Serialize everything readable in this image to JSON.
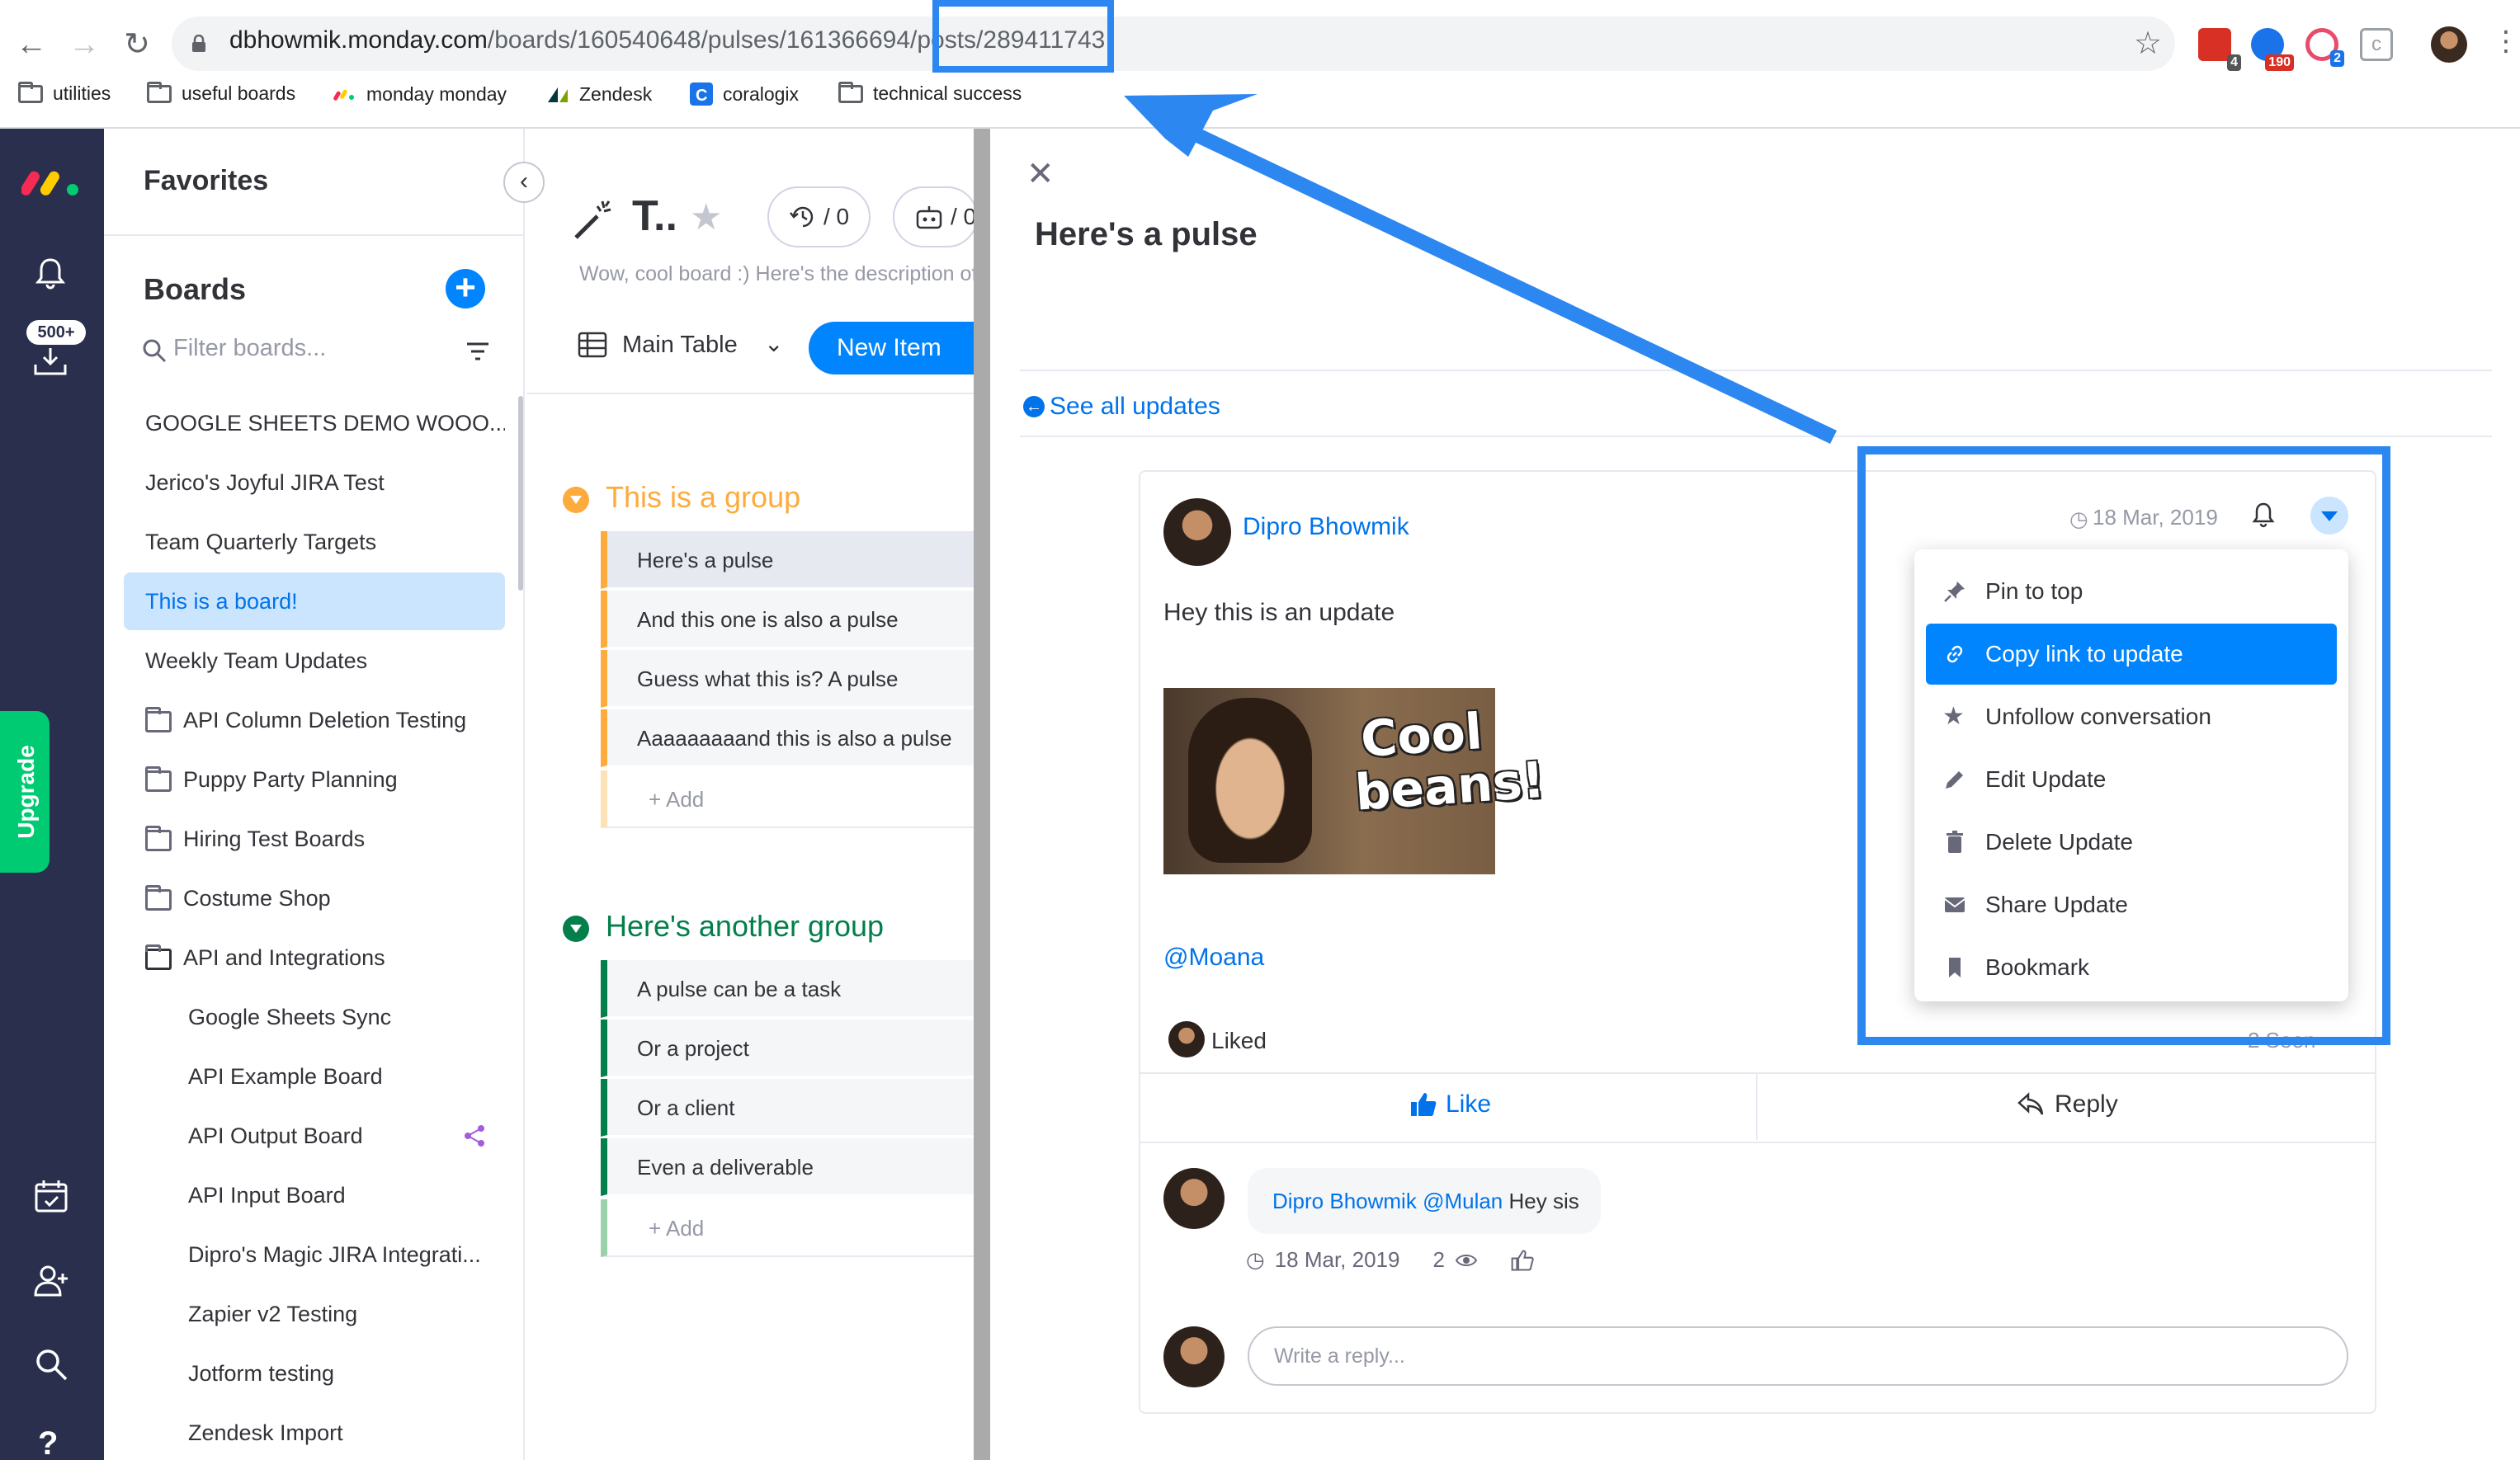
{
  "browser": {
    "url_host": "dbhowmik.monday.com",
    "url_path": "/boards/160540648/pulses/161366694/posts/289411743",
    "extensions": [
      {
        "icon": "calendar-ext-icon",
        "badge": "4",
        "color": "#d93025",
        "badge_color": "#555555"
      },
      {
        "icon": "check-ext-icon",
        "badge": "190",
        "color": "#1a73e8",
        "badge_color": "#d93025"
      },
      {
        "icon": "target-ext-icon",
        "badge": "2",
        "color": "#e94b6a",
        "badge_color": "#1a73e8"
      },
      {
        "icon": "c-ext-icon",
        "badge": "",
        "color": "#9aa0a6",
        "badge_color": ""
      }
    ],
    "bookmarks": [
      {
        "label": "utilities",
        "icon": "folder-icon"
      },
      {
        "label": "useful boards",
        "icon": "folder-icon"
      },
      {
        "label": "monday monday",
        "icon": "monday-logo-icon"
      },
      {
        "label": "Zendesk",
        "icon": "zendesk-logo-icon"
      },
      {
        "label": "coralogix",
        "icon": "coralogix-logo-icon"
      },
      {
        "label": "technical success",
        "icon": "folder-icon"
      }
    ]
  },
  "leftbar": {
    "notifications_badge": "500+",
    "upgrade_label": "Upgrade",
    "upgrade_color": "#00ca72"
  },
  "sidebar": {
    "favorites_title": "Favorites",
    "boards_title": "Boards",
    "filter_placeholder": "Filter boards...",
    "boards": [
      {
        "label": "GOOGLE SHEETS DEMO WOOO...",
        "type": "board"
      },
      {
        "label": "Jerico's Joyful JIRA Test",
        "type": "board"
      },
      {
        "label": "Team Quarterly Targets",
        "type": "board"
      },
      {
        "label": "This is a board!",
        "type": "board",
        "active": true
      },
      {
        "label": "Weekly Team Updates",
        "type": "board"
      },
      {
        "label": "API Column Deletion Testing",
        "type": "folder"
      },
      {
        "label": "Puppy Party Planning",
        "type": "folder"
      },
      {
        "label": "Hiring Test Boards",
        "type": "folder"
      },
      {
        "label": "Costume Shop",
        "type": "folder"
      },
      {
        "label": "API and Integrations",
        "type": "folder-open"
      },
      {
        "label": "Google Sheets Sync",
        "type": "sub"
      },
      {
        "label": "API Example Board",
        "type": "sub"
      },
      {
        "label": "API Output Board",
        "type": "sub",
        "shared": true
      },
      {
        "label": "API Input Board",
        "type": "sub"
      },
      {
        "label": "Dipro's Magic JIRA Integrati...",
        "type": "sub"
      },
      {
        "label": "Zapier v2 Testing",
        "type": "sub"
      },
      {
        "label": "Jotform testing",
        "type": "sub"
      },
      {
        "label": "Zendesk Import",
        "type": "sub"
      }
    ]
  },
  "board": {
    "title": "T..",
    "activity_count": "/ 0",
    "automation_count": "/ 0",
    "description": "Wow, cool board :) Here's the description of the board",
    "view_tab": "Main Table",
    "new_item_label": "New Item",
    "groups": [
      {
        "title": "This is a group",
        "color": "#fdab3d",
        "items": [
          "Here's a pulse",
          "And this one is also a pulse",
          "Guess what this is? A pulse",
          "Aaaaaaaaand this is also a pulse"
        ],
        "add_label": "+ Add"
      },
      {
        "title": "Here's another group",
        "color": "#037f4c",
        "items": [
          "A pulse can be a task",
          "Or a project",
          "Or a client",
          "Even a deliverable"
        ],
        "add_label": "+ Add"
      }
    ]
  },
  "item_panel": {
    "title": "Here's a pulse",
    "see_all_label": "See all updates",
    "update": {
      "author": "Dipro Bhowmik",
      "date": "18 Mar, 2019",
      "body": "Hey this is an update",
      "gif_caption": "Cool beans!",
      "mention": "@Moana",
      "liked_label": "Liked",
      "seen_label": "2 Seen",
      "like_label": "Like",
      "reply_label": "Reply"
    },
    "reply": {
      "author": "Dipro Bhowmik",
      "mention": "@Mulan",
      "text": "Hey sis",
      "date": "18 Mar, 2019",
      "seen_count": "2"
    },
    "reply_placeholder": "Write a reply..."
  },
  "context_menu": {
    "items": [
      {
        "label": "Pin to top",
        "icon": "pin-icon"
      },
      {
        "label": "Copy link to update",
        "icon": "link-icon",
        "selected": true
      },
      {
        "label": "Unfollow conversation",
        "icon": "star-icon"
      },
      {
        "label": "Edit Update",
        "icon": "pencil-icon"
      },
      {
        "label": "Delete Update",
        "icon": "trash-icon"
      },
      {
        "label": "Share Update",
        "icon": "mail-icon"
      },
      {
        "label": "Bookmark",
        "icon": "bookmark-icon"
      }
    ]
  },
  "annotation": {
    "color": "#2d87f0"
  }
}
